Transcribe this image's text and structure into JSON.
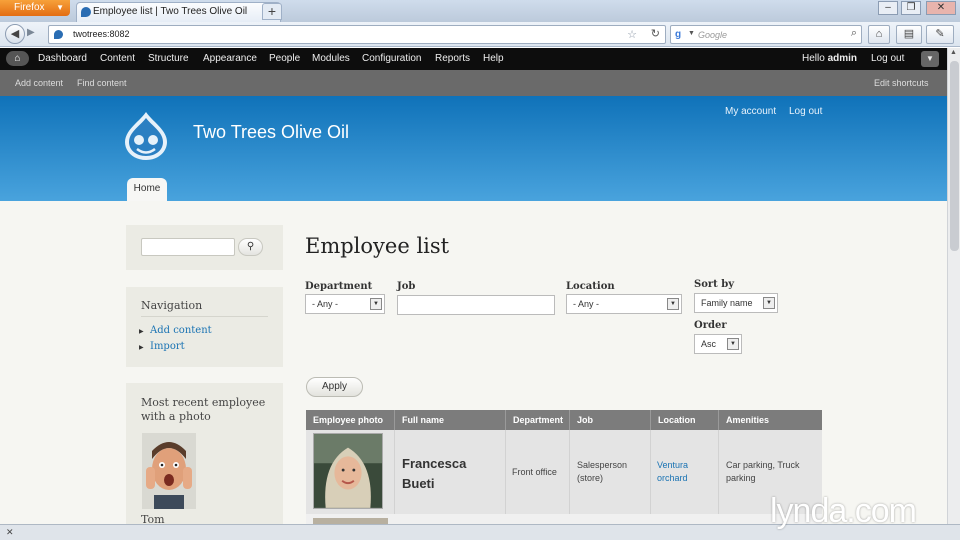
{
  "browser": {
    "app_button": "Firefox",
    "tab_title": "Employee list | Two Trees Olive Oil",
    "url": "twotrees:8082",
    "search_placeholder": "Google"
  },
  "toolbar": {
    "items": [
      "Dashboard",
      "Content",
      "Structure",
      "Appearance",
      "People",
      "Modules",
      "Configuration",
      "Reports",
      "Help"
    ],
    "hello_prefix": "Hello",
    "user": "admin",
    "logout": "Log out"
  },
  "shortcuts": {
    "items": [
      "Add content",
      "Find content"
    ],
    "edit": "Edit shortcuts"
  },
  "header": {
    "site_name": "Two Trees Olive Oil",
    "my_account": "My account",
    "logout": "Log out",
    "home_tab": "Home"
  },
  "sidebar": {
    "nav_title": "Navigation",
    "nav_items": [
      "Add content",
      "Import"
    ],
    "recent_title_line1": "Most recent employee",
    "recent_title_line2": "with a photo",
    "recent_name": "Tom"
  },
  "main": {
    "title": "Employee list",
    "filters": {
      "department_label": "Department",
      "department_value": "- Any -",
      "job_label": "Job",
      "job_value": "",
      "location_label": "Location",
      "location_value": "- Any -",
      "sort_label": "Sort by",
      "sort_value": "Family name",
      "order_label": "Order",
      "order_value": "Asc",
      "apply": "Apply"
    },
    "table": {
      "headers": [
        "Employee photo",
        "Full name",
        "Department",
        "Job",
        "Location",
        "Amenities"
      ],
      "rows": [
        {
          "name_first": "Francesca",
          "name_last": "Bueti",
          "department": "Front office",
          "job_line1": "Salesperson",
          "job_line2": "(store)",
          "location_line1": "Ventura",
          "location_line2": "orchard",
          "amenities_line1": "Car parking, Truck",
          "amenities_line2": "parking"
        }
      ]
    }
  },
  "watermark": "lynda.com",
  "colors": {
    "header_blue": "#0f72b9",
    "link_blue": "#1a73b3",
    "toolbar_black": "#0d0d0d"
  }
}
